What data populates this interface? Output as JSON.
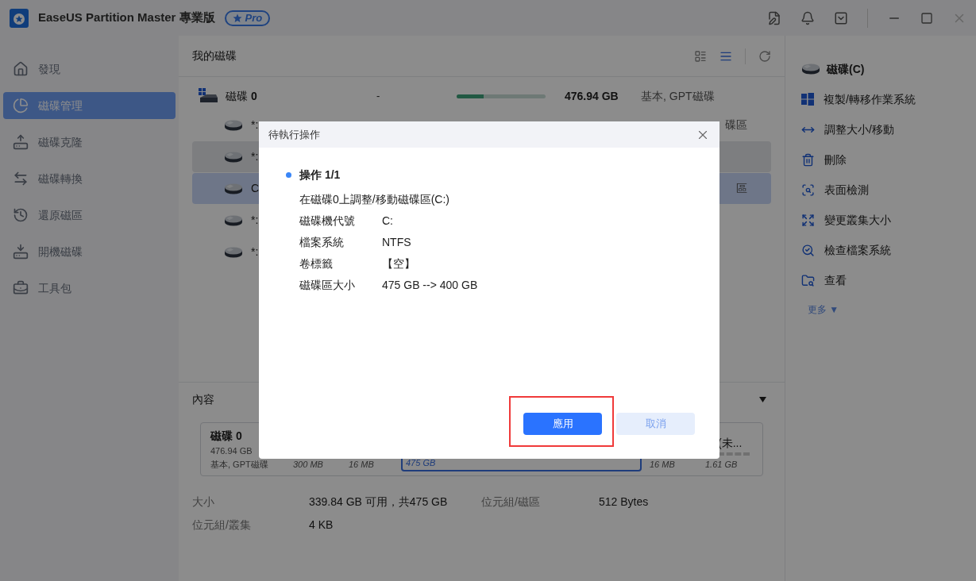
{
  "window": {
    "title": "EaseUS Partition Master 專業版",
    "badge": "Pro"
  },
  "sidebar": {
    "items": [
      {
        "label": "發現",
        "selected": false
      },
      {
        "label": "磁碟管理",
        "selected": true
      },
      {
        "label": "磁碟克隆",
        "selected": false
      },
      {
        "label": "磁碟轉換",
        "selected": false
      },
      {
        "label": "還原磁區",
        "selected": false
      },
      {
        "label": "開機磁碟",
        "selected": false
      },
      {
        "label": "工具包",
        "selected": false
      }
    ]
  },
  "disks": {
    "title": "我的磁碟",
    "views": [
      {
        "kind": "grid",
        "selected": false
      },
      {
        "kind": "list",
        "selected": true
      }
    ],
    "disk": {
      "name": "磁碟 **0**",
      "column_2": "-",
      "level": 0.3,
      "size": "476.94 GB",
      "type": "基本, GPT磁碟"
    },
    "partitions": [
      {
        "name": "*:",
        "tail": "碟區",
        "selected": false,
        "hover": false
      },
      {
        "name": "*:",
        "selected": false,
        "hover": true
      },
      {
        "name": "C",
        "tail": "區",
        "selected": true,
        "hover": false
      },
      {
        "name": "*:",
        "selected": false,
        "hover": false
      },
      {
        "name": "*:",
        "selected": false,
        "hover": false
      }
    ]
  },
  "details": {
    "title": "內容",
    "map": {
      "disk_name": "磁碟 **0**",
      "disk_size": "476.94 GB",
      "disk_type": "基本, GPT磁碟",
      "segments": [
        {
          "size": "300 MB",
          "selected": false
        },
        {
          "size": "16 MB",
          "selected": false
        },
        {
          "size": "475 GB",
          "selected": true
        },
        {
          "size": "16 MB",
          "selected": false
        },
        {
          "size": "1.61 GB",
          "label": "(未...",
          "selected": false
        }
      ]
    },
    "properties": [
      {
        "label": "大小",
        "value": "339.84 GB 可用，共475 GB"
      },
      {
        "label": "位元組/磁區",
        "value": "512 Bytes"
      },
      {
        "label": "位元組/叢集",
        "value": "4 KB"
      }
    ]
  },
  "actions": {
    "title": "磁碟(C)",
    "items": [
      {
        "label": "複製/轉移作業系統"
      },
      {
        "label": "調整大小/移動"
      },
      {
        "label": "刪除"
      },
      {
        "label": "表面檢測"
      },
      {
        "label": "變更叢集大小"
      },
      {
        "label": "檢查檔案系統"
      },
      {
        "label": "查看"
      }
    ],
    "more": "更多 ▼"
  },
  "dialog": {
    "title": "待執行操作",
    "operation": {
      "heading": "操作 1/1",
      "description": "在磁碟0上調整/移動磁碟區(C:)",
      "fields": [
        {
          "label": "磁碟機代號",
          "value": "C:"
        },
        {
          "label": "檔案系統",
          "value": "NTFS"
        },
        {
          "label": "卷標籤",
          "value": "【空】"
        },
        {
          "label": "磁碟區大小",
          "value": "475 GB --> 400 GB"
        }
      ]
    },
    "buttons": [
      {
        "label": "應用",
        "kind": "primary",
        "highlight": true
      },
      {
        "label": "取消",
        "kind": "secondary",
        "highlight": false
      }
    ]
  }
}
